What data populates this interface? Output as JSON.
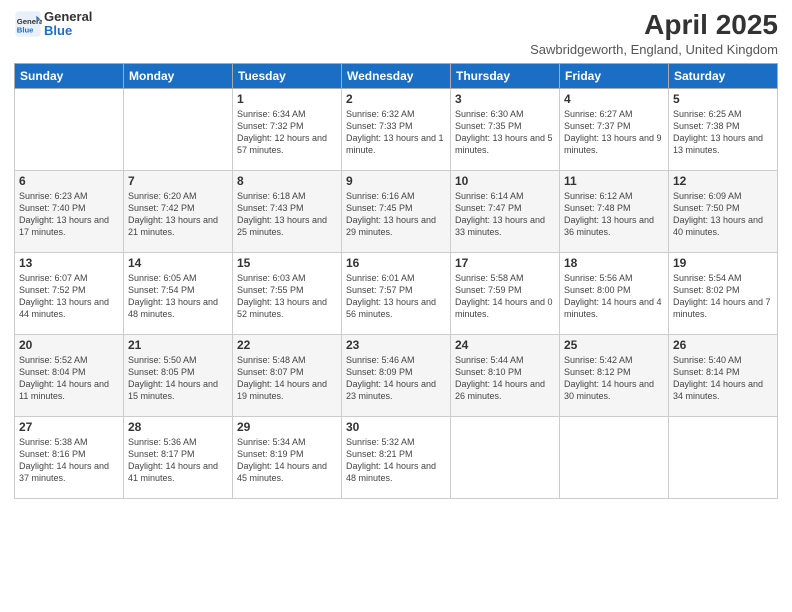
{
  "logo": {
    "line1": "General",
    "line2": "Blue"
  },
  "title": "April 2025",
  "subtitle": "Sawbridgeworth, England, United Kingdom",
  "days_of_week": [
    "Sunday",
    "Monday",
    "Tuesday",
    "Wednesday",
    "Thursday",
    "Friday",
    "Saturday"
  ],
  "weeks": [
    [
      {
        "day": "",
        "info": ""
      },
      {
        "day": "",
        "info": ""
      },
      {
        "day": "1",
        "info": "Sunrise: 6:34 AM\nSunset: 7:32 PM\nDaylight: 12 hours and 57 minutes."
      },
      {
        "day": "2",
        "info": "Sunrise: 6:32 AM\nSunset: 7:33 PM\nDaylight: 13 hours and 1 minute."
      },
      {
        "day": "3",
        "info": "Sunrise: 6:30 AM\nSunset: 7:35 PM\nDaylight: 13 hours and 5 minutes."
      },
      {
        "day": "4",
        "info": "Sunrise: 6:27 AM\nSunset: 7:37 PM\nDaylight: 13 hours and 9 minutes."
      },
      {
        "day": "5",
        "info": "Sunrise: 6:25 AM\nSunset: 7:38 PM\nDaylight: 13 hours and 13 minutes."
      }
    ],
    [
      {
        "day": "6",
        "info": "Sunrise: 6:23 AM\nSunset: 7:40 PM\nDaylight: 13 hours and 17 minutes."
      },
      {
        "day": "7",
        "info": "Sunrise: 6:20 AM\nSunset: 7:42 PM\nDaylight: 13 hours and 21 minutes."
      },
      {
        "day": "8",
        "info": "Sunrise: 6:18 AM\nSunset: 7:43 PM\nDaylight: 13 hours and 25 minutes."
      },
      {
        "day": "9",
        "info": "Sunrise: 6:16 AM\nSunset: 7:45 PM\nDaylight: 13 hours and 29 minutes."
      },
      {
        "day": "10",
        "info": "Sunrise: 6:14 AM\nSunset: 7:47 PM\nDaylight: 13 hours and 33 minutes."
      },
      {
        "day": "11",
        "info": "Sunrise: 6:12 AM\nSunset: 7:48 PM\nDaylight: 13 hours and 36 minutes."
      },
      {
        "day": "12",
        "info": "Sunrise: 6:09 AM\nSunset: 7:50 PM\nDaylight: 13 hours and 40 minutes."
      }
    ],
    [
      {
        "day": "13",
        "info": "Sunrise: 6:07 AM\nSunset: 7:52 PM\nDaylight: 13 hours and 44 minutes."
      },
      {
        "day": "14",
        "info": "Sunrise: 6:05 AM\nSunset: 7:54 PM\nDaylight: 13 hours and 48 minutes."
      },
      {
        "day": "15",
        "info": "Sunrise: 6:03 AM\nSunset: 7:55 PM\nDaylight: 13 hours and 52 minutes."
      },
      {
        "day": "16",
        "info": "Sunrise: 6:01 AM\nSunset: 7:57 PM\nDaylight: 13 hours and 56 minutes."
      },
      {
        "day": "17",
        "info": "Sunrise: 5:58 AM\nSunset: 7:59 PM\nDaylight: 14 hours and 0 minutes."
      },
      {
        "day": "18",
        "info": "Sunrise: 5:56 AM\nSunset: 8:00 PM\nDaylight: 14 hours and 4 minutes."
      },
      {
        "day": "19",
        "info": "Sunrise: 5:54 AM\nSunset: 8:02 PM\nDaylight: 14 hours and 7 minutes."
      }
    ],
    [
      {
        "day": "20",
        "info": "Sunrise: 5:52 AM\nSunset: 8:04 PM\nDaylight: 14 hours and 11 minutes."
      },
      {
        "day": "21",
        "info": "Sunrise: 5:50 AM\nSunset: 8:05 PM\nDaylight: 14 hours and 15 minutes."
      },
      {
        "day": "22",
        "info": "Sunrise: 5:48 AM\nSunset: 8:07 PM\nDaylight: 14 hours and 19 minutes."
      },
      {
        "day": "23",
        "info": "Sunrise: 5:46 AM\nSunset: 8:09 PM\nDaylight: 14 hours and 23 minutes."
      },
      {
        "day": "24",
        "info": "Sunrise: 5:44 AM\nSunset: 8:10 PM\nDaylight: 14 hours and 26 minutes."
      },
      {
        "day": "25",
        "info": "Sunrise: 5:42 AM\nSunset: 8:12 PM\nDaylight: 14 hours and 30 minutes."
      },
      {
        "day": "26",
        "info": "Sunrise: 5:40 AM\nSunset: 8:14 PM\nDaylight: 14 hours and 34 minutes."
      }
    ],
    [
      {
        "day": "27",
        "info": "Sunrise: 5:38 AM\nSunset: 8:16 PM\nDaylight: 14 hours and 37 minutes."
      },
      {
        "day": "28",
        "info": "Sunrise: 5:36 AM\nSunset: 8:17 PM\nDaylight: 14 hours and 41 minutes."
      },
      {
        "day": "29",
        "info": "Sunrise: 5:34 AM\nSunset: 8:19 PM\nDaylight: 14 hours and 45 minutes."
      },
      {
        "day": "30",
        "info": "Sunrise: 5:32 AM\nSunset: 8:21 PM\nDaylight: 14 hours and 48 minutes."
      },
      {
        "day": "",
        "info": ""
      },
      {
        "day": "",
        "info": ""
      },
      {
        "day": "",
        "info": ""
      }
    ]
  ]
}
